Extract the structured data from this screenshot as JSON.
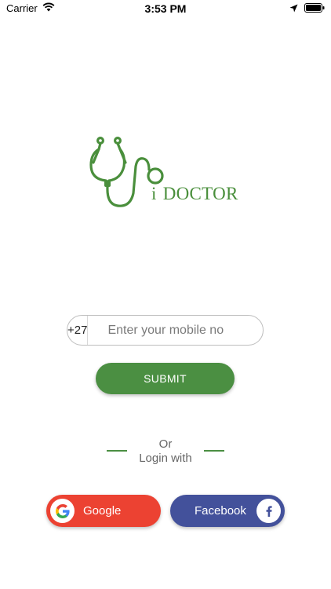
{
  "status_bar": {
    "carrier": "Carrier",
    "time": "3:53 PM"
  },
  "logo": {
    "i_letter": "i",
    "text": "DOCTOR",
    "color": "#4a8f3c"
  },
  "login": {
    "country_code": "+27",
    "phone_placeholder": "Enter your mobile no",
    "submit_label": "SUBMIT"
  },
  "divider": {
    "line1": "Or",
    "line2": "Login with"
  },
  "social": {
    "google_label": "Google",
    "facebook_label": "Facebook",
    "google_icon": "google-g-icon",
    "facebook_icon": "facebook-f-icon"
  },
  "colors": {
    "brand_green": "#4b8f42",
    "google_red": "#ec4232",
    "facebook_blue": "#43519b"
  }
}
